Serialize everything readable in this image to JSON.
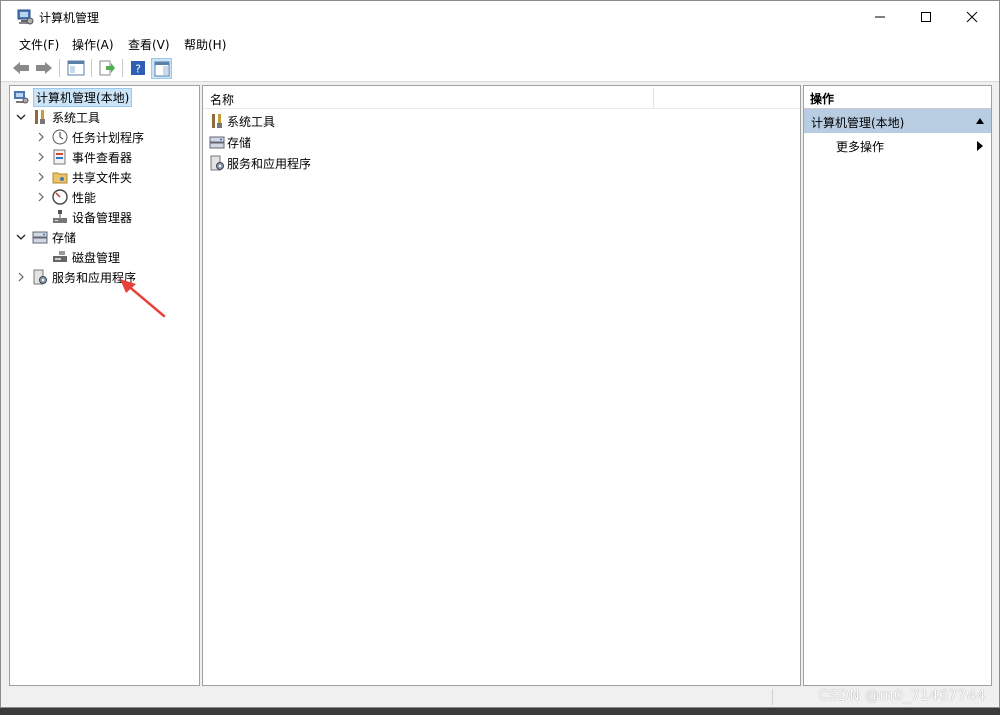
{
  "window": {
    "title": "计算机管理"
  },
  "menu": [
    "文件(F)",
    "操作(A)",
    "查看(V)",
    "帮助(H)"
  ],
  "tree": {
    "root": "计算机管理(本地)",
    "system_tools": "系统工具",
    "task_scheduler": "任务计划程序",
    "event_viewer": "事件查看器",
    "shared_folders": "共享文件夹",
    "performance": "性能",
    "device_manager": "设备管理器",
    "storage": "存储",
    "disk_management": "磁盘管理",
    "services_apps": "服务和应用程序"
  },
  "list": {
    "column_name": "名称",
    "rows": [
      "系统工具",
      "存储",
      "服务和应用程序"
    ]
  },
  "actions": {
    "header": "操作",
    "section": "计算机管理(本地)",
    "more": "更多操作"
  },
  "watermark": "CSDN @m0_71467744",
  "colors": {
    "selection": "#cce4f7",
    "action_section": "#b9cde2",
    "arrow": "#e8413c"
  }
}
